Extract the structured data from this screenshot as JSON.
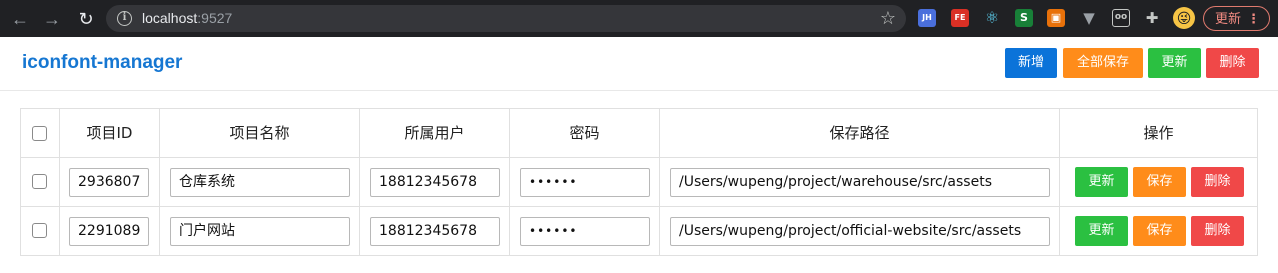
{
  "browser": {
    "url_host": "localhost",
    "url_port": ":9527",
    "extensions": [
      "JH",
      "FE",
      "⚛",
      "S",
      "▣",
      "▼",
      "oo",
      "✚"
    ],
    "update_label": "更新",
    "menu_dots": "⋮"
  },
  "app": {
    "title": "iconfont-manager",
    "toolbar": {
      "add_label": "新增",
      "save_all_label": "全部保存",
      "update_label": "更新",
      "delete_label": "删除"
    }
  },
  "table": {
    "headers": {
      "id": "项目ID",
      "name": "项目名称",
      "user": "所属用户",
      "password": "密码",
      "path": "保存路径",
      "actions": "操作"
    },
    "row_actions": {
      "update_label": "更新",
      "save_label": "保存",
      "delete_label": "删除"
    },
    "rows": [
      {
        "id": "2936807",
        "name": "仓库系统",
        "user": "18812345678",
        "password": "••••••",
        "path": "/Users/wupeng/project/warehouse/src/assets"
      },
      {
        "id": "2291089",
        "name": "门户网站",
        "user": "18812345678",
        "password": "••••••",
        "path": "/Users/wupeng/project/official-website/src/assets"
      }
    ]
  },
  "colors": {
    "brand": "#1677d2",
    "add": "#0b73d9",
    "save": "#ff8c1a",
    "update": "#2bc041",
    "delete": "#f04848"
  }
}
